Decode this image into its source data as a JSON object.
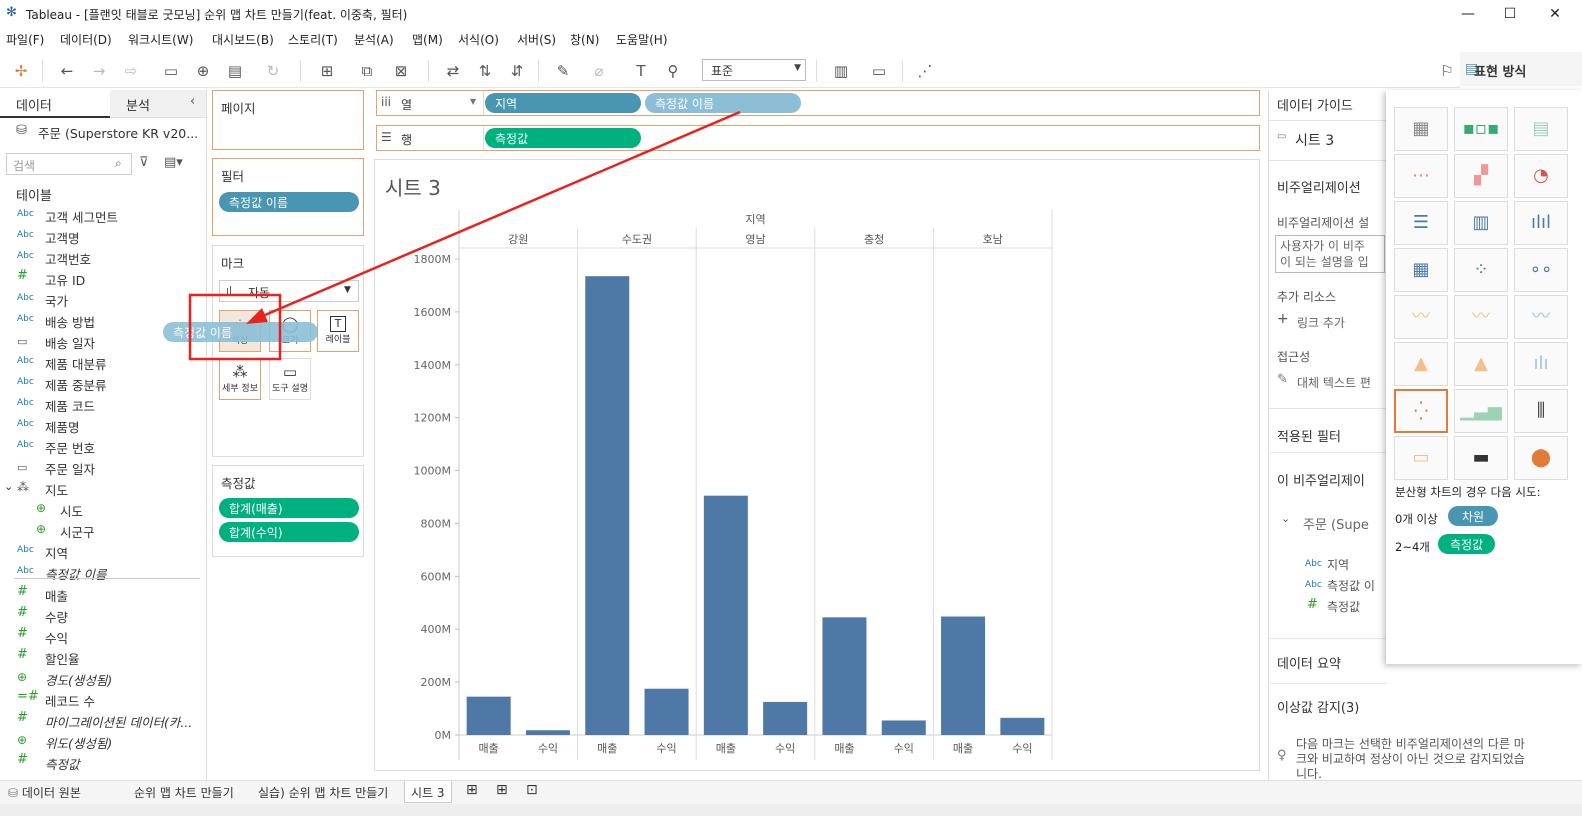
{
  "window": {
    "title": "Tableau - [플랜잇 태블로 굿모닝] 순위 맵 차트 만들기(feat. 이중축, 필터)"
  },
  "menu": [
    "파일(F)",
    "데이터(D)",
    "워크시트(W)",
    "대시보드(B)",
    "스토리(T)",
    "분석(A)",
    "맵(M)",
    "서식(O)",
    "서버(S)",
    "창(N)",
    "도움말(H)"
  ],
  "toolbar": {
    "standard_select": "표준",
    "show_me": "표현 방식"
  },
  "left_pane": {
    "tab_data": "데이터",
    "tab_analysis": "분석",
    "datasource": "주문 (Superstore KR v20...",
    "search_placeholder": "검색",
    "tables_header": "테이블",
    "fields": [
      {
        "icon": "Abc",
        "name": "고객 세그먼트"
      },
      {
        "icon": "Abc",
        "name": "고객명"
      },
      {
        "icon": "Abc",
        "name": "고객번호"
      },
      {
        "icon": "#",
        "name": "고유 ID"
      },
      {
        "icon": "Abc",
        "name": "국가"
      },
      {
        "icon": "Abc",
        "name": "배송 방법"
      },
      {
        "icon": "date",
        "name": "배송 일자"
      },
      {
        "icon": "Abc",
        "name": "제품 대분류"
      },
      {
        "icon": "Abc",
        "name": "제품 중분류"
      },
      {
        "icon": "Abc",
        "name": "제품 코드"
      },
      {
        "icon": "Abc",
        "name": "제품명"
      },
      {
        "icon": "Abc",
        "name": "주문 번호"
      },
      {
        "icon": "date",
        "name": "주문 일자"
      },
      {
        "icon": "hier",
        "name": "지도"
      },
      {
        "icon": "globe",
        "name": "시도"
      },
      {
        "icon": "globe",
        "name": "시군구"
      },
      {
        "icon": "Abc",
        "name": "지역"
      },
      {
        "icon": "Abc",
        "name": "측정값 이름"
      },
      {
        "icon": "#",
        "name": "매출"
      },
      {
        "icon": "#",
        "name": "수량"
      },
      {
        "icon": "#",
        "name": "수익"
      },
      {
        "icon": "#",
        "name": "할인율"
      },
      {
        "icon": "globe",
        "name": "경도(생성됨)"
      },
      {
        "icon": "=#",
        "name": "레코드 수"
      },
      {
        "icon": "#",
        "name": "마이그레이션된 데이터(카..."
      },
      {
        "icon": "globe",
        "name": "위도(생성됨)"
      },
      {
        "icon": "#",
        "name": "측정값"
      }
    ]
  },
  "shelves": {
    "pages": "페이지",
    "filters": "필터",
    "filter_pill": "측정값 이름",
    "marks": "마크",
    "mark_type": "자동",
    "mark_color": "색상",
    "mark_size": "크기",
    "mark_label": "레이블",
    "mark_detail": "세부 정보",
    "mark_tooltip": "도구 설명",
    "drag_pill": "측정값 이름",
    "measures": "측정값",
    "measure_pills": [
      "합계(매출)",
      "합계(수익)"
    ],
    "columns_label": "열",
    "rows_label": "행",
    "columns_pills": [
      "지역",
      "측정값 이름"
    ],
    "rows_pills": [
      "측정값"
    ]
  },
  "sheet_title": "시트 3",
  "chart_data": {
    "type": "bar",
    "xlabel": "지역",
    "panes": [
      "강원",
      "수도권",
      "영남",
      "충청",
      "호남"
    ],
    "categories": [
      "매출",
      "수익"
    ],
    "series": [
      {
        "pane": "강원",
        "values": [
          145,
          18
        ]
      },
      {
        "pane": "수도권",
        "values": [
          1735,
          175
        ]
      },
      {
        "pane": "영남",
        "values": [
          905,
          125
        ]
      },
      {
        "pane": "충청",
        "values": [
          445,
          55
        ]
      },
      {
        "pane": "호남",
        "values": [
          448,
          65
        ]
      }
    ],
    "ylim": [
      0,
      1800
    ],
    "yticks": [
      "0M",
      "200M",
      "400M",
      "600M",
      "800M",
      "1000M",
      "1200M",
      "1400M",
      "1600M",
      "1800M"
    ],
    "bar_color": "#4e79a7"
  },
  "right_pane": {
    "data_guide": "데이터 가이드",
    "sheet": "시트 3",
    "viz_desc": "비주얼리제이션",
    "viz_desc_sub": "비주얼리제이션 설",
    "desc_box": "사용자가 이 비주\n이 되는 설명을 입",
    "extra_resources": "추가 리소스",
    "add_link": "링크 추가",
    "accessibility": "접근성",
    "alt_text": "대체 텍스트 편",
    "applied_filters": "적용된 필터",
    "this_viz": "이 비주얼리제이",
    "source": "주문 (Supe",
    "fields": [
      {
        "icon": "Abc",
        "name": "지역"
      },
      {
        "icon": "Abc",
        "name": "측정값 이"
      },
      {
        "icon": "#",
        "name": "측정값"
      }
    ],
    "data_summary": "데이터 요약",
    "outlier": "이상값 감지(3)",
    "outlier_text": "다음 마크는 선택한 비주얼리제이션의 다른 마\n크와 비교하여 정상이 아닌 것으로 감지되었습\n니다."
  },
  "show_me": {
    "hint": "분산형 차트의 경우 다음 시도:",
    "dim_req": "0개 이상",
    "dim_pill": "차원",
    "mea_req": "2~4개",
    "mea_pill": "측정값"
  },
  "sheet_tabs": [
    "데이터 원본",
    "순위 맵 차트 만들기",
    "실습) 순위 맵 차트 만들기",
    "시트 3"
  ]
}
